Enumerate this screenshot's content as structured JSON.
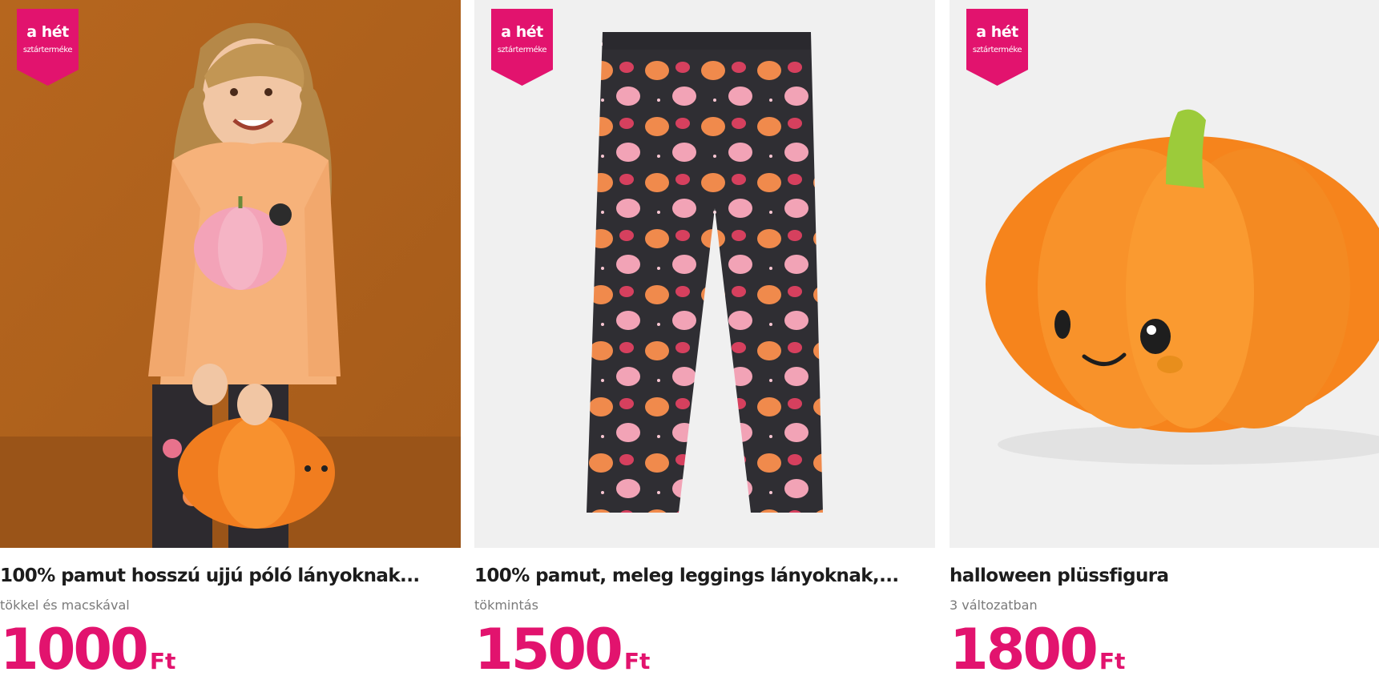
{
  "products": [
    {
      "badge": {
        "title": "a hét",
        "subtitle": "sztárterméke"
      },
      "title": "100% pamut hosszú ujjú póló lányoknak...",
      "subtitle": "tökkel és macskával",
      "price": "1000",
      "currency": "Ft"
    },
    {
      "badge": {
        "title": "a hét",
        "subtitle": "sztárterméke"
      },
      "title": "100% pamut, meleg leggings lányoknak,...",
      "subtitle": "tökmintás",
      "price": "1500",
      "currency": "Ft"
    },
    {
      "badge": {
        "title": "a hét",
        "subtitle": "sztárterméke"
      },
      "title": "halloween plüssfigura",
      "subtitle": "3 változatban",
      "price": "1800",
      "currency": "Ft"
    }
  ],
  "colors": {
    "accent": "#e2136e",
    "title": "#1c1c1c",
    "subtitle": "#7a7a7a",
    "image_background": "#f0f0f0"
  }
}
